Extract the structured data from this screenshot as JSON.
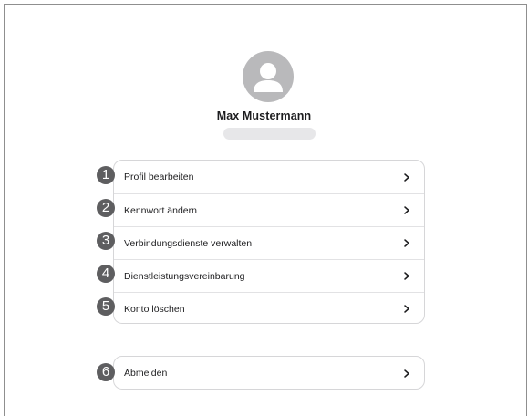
{
  "profile": {
    "name": "Max Mustermann",
    "avatar_icon": "user-avatar-icon"
  },
  "menu": {
    "items": [
      {
        "label": "Profil bearbeiten",
        "badge": "1"
      },
      {
        "label": "Kennwort ändern",
        "badge": "2"
      },
      {
        "label": "Verbindungsdienste verwalten",
        "badge": "3"
      },
      {
        "label": "Dienstleistungsvereinbarung",
        "badge": "4"
      },
      {
        "label": "Konto löschen",
        "badge": "5"
      }
    ]
  },
  "logout": {
    "label": "Abmelden",
    "badge": "6"
  },
  "colors": {
    "avatar_bg": "#b9b9bb",
    "badge_bg": "#5e5e60",
    "card_border": "#d6d6d8",
    "text": "#1d1d1f"
  }
}
